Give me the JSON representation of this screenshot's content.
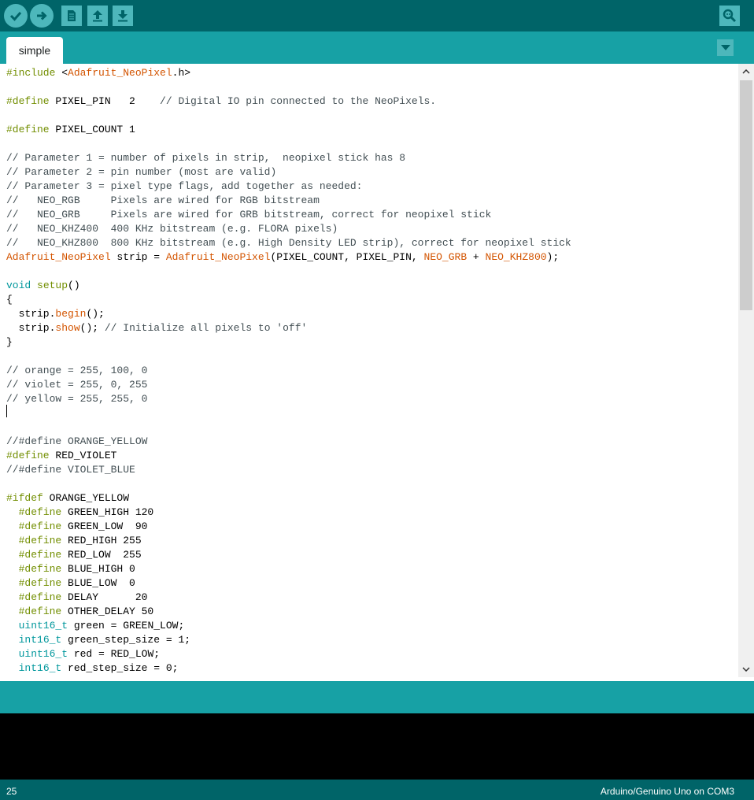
{
  "toolbar": {
    "buttons": [
      {
        "name": "verify",
        "icon": "checkmark-icon"
      },
      {
        "name": "upload",
        "icon": "arrow-right-icon"
      },
      {
        "name": "new",
        "icon": "document-icon"
      },
      {
        "name": "open",
        "icon": "arrow-up-icon"
      },
      {
        "name": "save",
        "icon": "arrow-down-icon"
      },
      {
        "name": "serial-monitor",
        "icon": "magnifier-icon"
      }
    ]
  },
  "tabs": [
    {
      "label": "simple",
      "active": true
    }
  ],
  "colors": {
    "toolbar_bg": "#006468",
    "tab_bar_bg": "#17a1a5",
    "button_bg": "#4db7bb",
    "keyword": "#728e00",
    "library": "#d35400",
    "type": "#00979c",
    "comment": "#434f54"
  },
  "editor": {
    "lines": [
      [
        {
          "t": "#include",
          "c": "k"
        },
        {
          "t": " <"
        },
        {
          "t": "Adafruit_NeoPixel",
          "c": "o"
        },
        {
          "t": ".h>"
        }
      ],
      [],
      [
        {
          "t": "#define",
          "c": "k"
        },
        {
          "t": " PIXEL_PIN   2    "
        },
        {
          "t": "// Digital IO pin connected to the NeoPixels.",
          "c": "c"
        }
      ],
      [],
      [
        {
          "t": "#define",
          "c": "k"
        },
        {
          "t": " PIXEL_COUNT 1"
        }
      ],
      [],
      [
        {
          "t": "// Parameter 1 = number of pixels in strip,  neopixel stick has 8",
          "c": "c"
        }
      ],
      [
        {
          "t": "// Parameter 2 = pin number (most are valid)",
          "c": "c"
        }
      ],
      [
        {
          "t": "// Parameter 3 = pixel type flags, add together as needed:",
          "c": "c"
        }
      ],
      [
        {
          "t": "//   NEO_RGB     Pixels are wired for RGB bitstream",
          "c": "c"
        }
      ],
      [
        {
          "t": "//   NEO_GRB     Pixels are wired for GRB bitstream, correct for neopixel stick",
          "c": "c"
        }
      ],
      [
        {
          "t": "//   NEO_KHZ400  400 KHz bitstream (e.g. FLORA pixels)",
          "c": "c"
        }
      ],
      [
        {
          "t": "//   NEO_KHZ800  800 KHz bitstream (e.g. High Density LED strip), correct for neopixel stick",
          "c": "c"
        }
      ],
      [
        {
          "t": "Adafruit_NeoPixel",
          "c": "o"
        },
        {
          "t": " strip = "
        },
        {
          "t": "Adafruit_NeoPixel",
          "c": "o"
        },
        {
          "t": "(PIXEL_COUNT, PIXEL_PIN, "
        },
        {
          "t": "NEO_GRB",
          "c": "o"
        },
        {
          "t": " + "
        },
        {
          "t": "NEO_KHZ800",
          "c": "o"
        },
        {
          "t": ");"
        }
      ],
      [],
      [
        {
          "t": "void",
          "c": "t"
        },
        {
          "t": " "
        },
        {
          "t": "setup",
          "c": "k"
        },
        {
          "t": "()"
        }
      ],
      [
        {
          "t": "{"
        }
      ],
      [
        {
          "t": "  strip."
        },
        {
          "t": "begin",
          "c": "o"
        },
        {
          "t": "();"
        }
      ],
      [
        {
          "t": "  strip."
        },
        {
          "t": "show",
          "c": "o"
        },
        {
          "t": "(); "
        },
        {
          "t": "// Initialize all pixels to 'off'",
          "c": "c"
        }
      ],
      [
        {
          "t": "}"
        }
      ],
      [],
      [
        {
          "t": "// orange = 255, 100, 0",
          "c": "c"
        }
      ],
      [
        {
          "t": "// violet = 255, 0, 255",
          "c": "c"
        }
      ],
      [
        {
          "t": "// yellow = 255, 255, 0",
          "c": "c"
        }
      ],
      [],
      [],
      [
        {
          "t": "//#define ORANGE_YELLOW",
          "c": "c"
        }
      ],
      [
        {
          "t": "#define",
          "c": "k"
        },
        {
          "t": " RED_VIOLET"
        }
      ],
      [
        {
          "t": "//#define VIOLET_BLUE",
          "c": "c"
        }
      ],
      [],
      [
        {
          "t": "#ifdef",
          "c": "k"
        },
        {
          "t": " ORANGE_YELLOW"
        }
      ],
      [
        {
          "t": "  "
        },
        {
          "t": "#define",
          "c": "k"
        },
        {
          "t": " GREEN_HIGH 120"
        }
      ],
      [
        {
          "t": "  "
        },
        {
          "t": "#define",
          "c": "k"
        },
        {
          "t": " GREEN_LOW  90"
        }
      ],
      [
        {
          "t": "  "
        },
        {
          "t": "#define",
          "c": "k"
        },
        {
          "t": " RED_HIGH 255"
        }
      ],
      [
        {
          "t": "  "
        },
        {
          "t": "#define",
          "c": "k"
        },
        {
          "t": " RED_LOW  255"
        }
      ],
      [
        {
          "t": "  "
        },
        {
          "t": "#define",
          "c": "k"
        },
        {
          "t": " BLUE_HIGH 0"
        }
      ],
      [
        {
          "t": "  "
        },
        {
          "t": "#define",
          "c": "k"
        },
        {
          "t": " BLUE_LOW  0"
        }
      ],
      [
        {
          "t": "  "
        },
        {
          "t": "#define",
          "c": "k"
        },
        {
          "t": " DELAY      20"
        }
      ],
      [
        {
          "t": "  "
        },
        {
          "t": "#define",
          "c": "k"
        },
        {
          "t": " OTHER_DELAY 50"
        }
      ],
      [
        {
          "t": "  "
        },
        {
          "t": "uint16_t",
          "c": "t"
        },
        {
          "t": " green = GREEN_LOW;"
        }
      ],
      [
        {
          "t": "  "
        },
        {
          "t": "int16_t",
          "c": "t"
        },
        {
          "t": " green_step_size = 1;"
        }
      ],
      [
        {
          "t": "  "
        },
        {
          "t": "uint16_t",
          "c": "t"
        },
        {
          "t": " red = RED_LOW;"
        }
      ],
      [
        {
          "t": "  "
        },
        {
          "t": "int16_t",
          "c": "t"
        },
        {
          "t": " red_step_size = 0;"
        }
      ]
    ]
  },
  "status": {
    "line": "25",
    "board": "Arduino/Genuino Uno on COM3"
  }
}
